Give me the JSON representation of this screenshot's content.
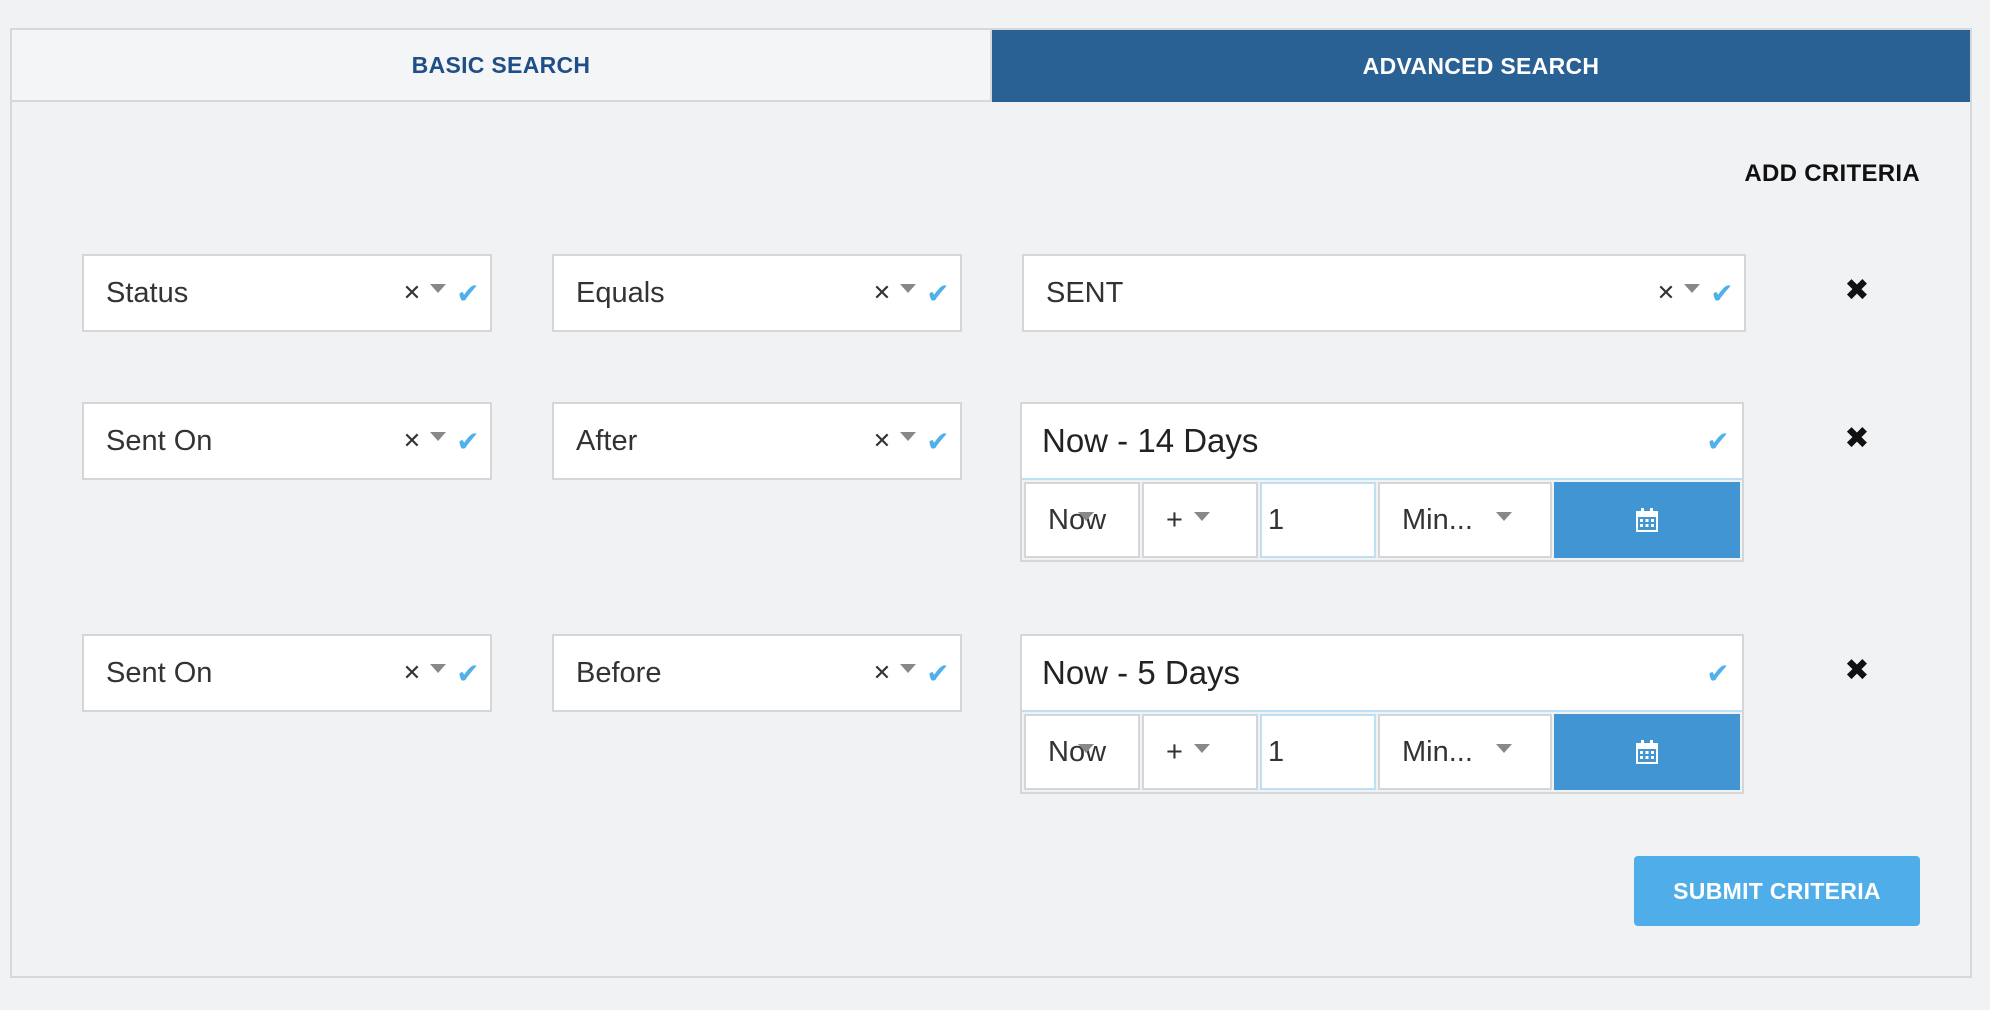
{
  "tabs": {
    "basic": "BASIC SEARCH",
    "advanced": "ADVANCED SEARCH"
  },
  "add_criteria": "ADD CRITERIA",
  "submit": "SUBMIT CRITERIA",
  "criteria": [
    {
      "field": "Status",
      "operator": "Equals",
      "value": "SENT"
    },
    {
      "field": "Sent On",
      "operator": "After",
      "value": "Now - 14 Days",
      "builder": {
        "base": "Now",
        "sign": "+",
        "amount": "1",
        "unit": "Min..."
      }
    },
    {
      "field": "Sent On",
      "operator": "Before",
      "value": "Now - 5 Days",
      "builder": {
        "base": "Now",
        "sign": "+",
        "amount": "1",
        "unit": "Min..."
      }
    }
  ],
  "icons": {
    "clear": "x-icon",
    "dropdown": "chevron-down-icon",
    "valid": "check-icon",
    "remove": "close-icon",
    "calendar": "calendar-icon"
  },
  "colors": {
    "active_tab": "#2a6195",
    "inactive_tab_text": "#1f4f86",
    "check": "#4fb0ea",
    "calendar_button": "#4195d3",
    "submit_button": "#4faeea"
  }
}
